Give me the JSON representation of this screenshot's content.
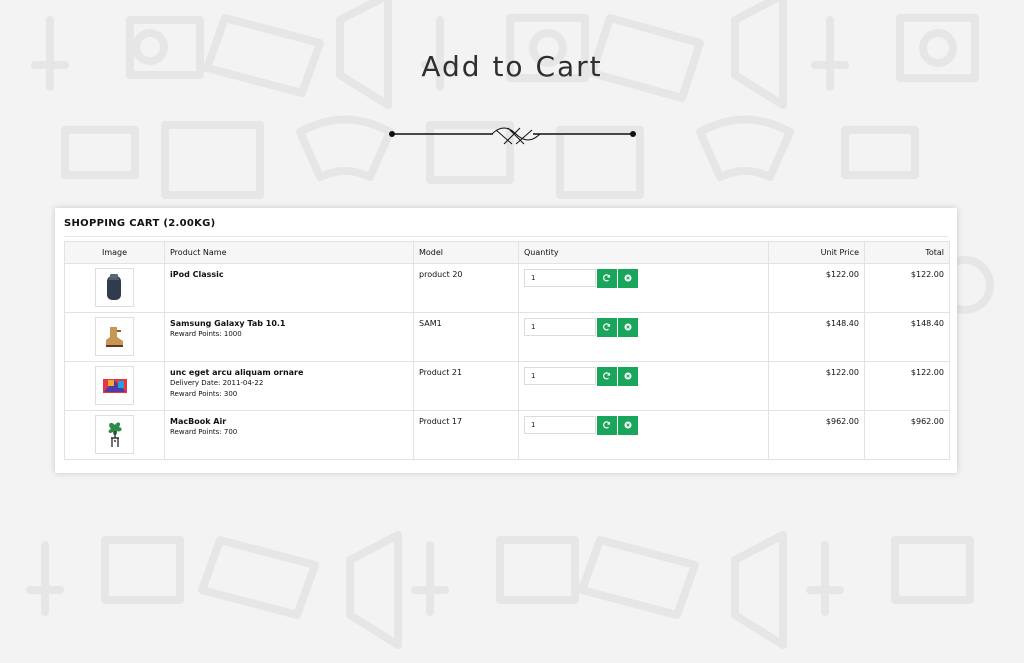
{
  "heading": "Add to Cart",
  "cart": {
    "title": "SHOPPING CART",
    "weight": "(2.00KG)",
    "columns": {
      "image": "Image",
      "product": "Product Name",
      "model": "Model",
      "quantity": "Quantity",
      "unit_price": "Unit Price",
      "total": "Total"
    },
    "items": [
      {
        "name": "iPod Classic",
        "details": [],
        "model": "product 20",
        "quantity": "1",
        "unit_price": "$122.00",
        "total": "$122.00",
        "image_icon": "speaker-thumbnail-icon"
      },
      {
        "name": "Samsung Galaxy Tab 10.1",
        "details": [
          "Reward Points: 1000"
        ],
        "model": "SAM1",
        "quantity": "1",
        "unit_price": "$148.40",
        "total": "$148.40",
        "image_icon": "boot-thumbnail-icon"
      },
      {
        "name": "unc eget arcu aliquam ornare",
        "details": [
          "Delivery Date: 2011-04-22",
          "Reward Points: 300"
        ],
        "model": "Product 21",
        "quantity": "1",
        "unit_price": "$122.00",
        "total": "$122.00",
        "image_icon": "colorful-box-thumbnail-icon"
      },
      {
        "name": "MacBook Air",
        "details": [
          "Reward Points: 700"
        ],
        "model": "Product 17",
        "quantity": "1",
        "unit_price": "$962.00",
        "total": "$962.00",
        "image_icon": "plant-stand-thumbnail-icon"
      }
    ]
  },
  "colors": {
    "accent_green": "#1aa65a",
    "background": "#f3f3f3",
    "pattern": "#e4e4e4"
  },
  "icons": {
    "update_button": "refresh-icon",
    "remove_button": "close-circle-icon",
    "divider": "ornamental-divider-icon"
  }
}
